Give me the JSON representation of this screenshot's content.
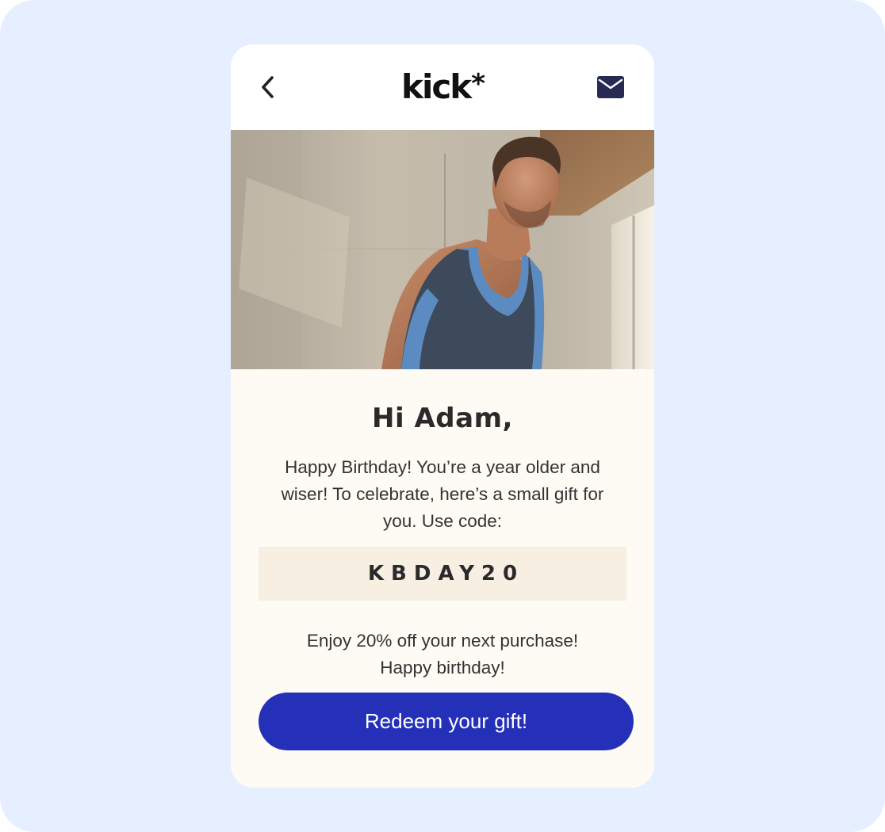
{
  "brand": {
    "logo_text": "kick",
    "logo_mark": "*"
  },
  "header": {
    "back_icon": "chevron-left-icon",
    "mail_icon": "envelope-icon"
  },
  "hero": {
    "image": "man-in-athletic-tank-top-photo"
  },
  "email": {
    "greeting": "Hi Adam,",
    "message": "Happy Birthday! You’re a year older and wiser! To celebrate, here’s a small gift for you. Use code:",
    "promo_code": "KBDAY20",
    "offer_line1": "Enjoy 20% off your next purchase!",
    "offer_line2": "Happy birthday!",
    "cta_label": "Redeem your gift!"
  },
  "colors": {
    "background": "#e5efff",
    "card": "#fdfbf4",
    "code_box": "#f6efe2",
    "cta": "#2530b9",
    "mail_icon": "#262b54"
  }
}
